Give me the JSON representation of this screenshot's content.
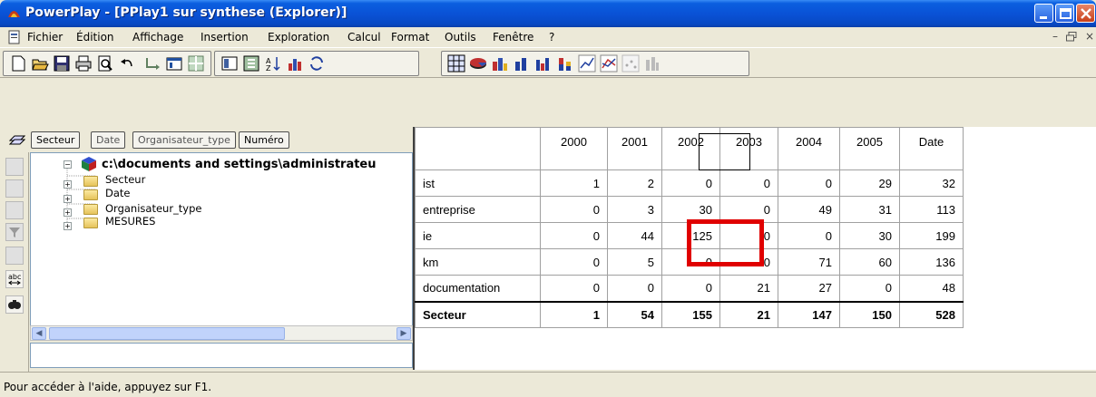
{
  "window": {
    "title": "PowerPlay - [PPlay1 sur synthese (Explorer)]"
  },
  "menu": {
    "items": [
      "Fichier",
      "Édition",
      "Affichage",
      "Insertion",
      "Exploration",
      "Calcul",
      "Format",
      "Outils",
      "Fenêtre",
      "?"
    ]
  },
  "dimension_line": {
    "buttons": [
      "Secteur",
      "Date",
      "Organisateur_type",
      "Numéro"
    ]
  },
  "tree": {
    "root": "c:\\documents and settings\\administrateu",
    "items": [
      "Secteur",
      "Date",
      "Organisateur_type",
      "MESURES"
    ]
  },
  "crosstab": {
    "columns": [
      "2000",
      "2001",
      "2002",
      "2003",
      "2004",
      "2005",
      "Date"
    ],
    "rows": [
      {
        "label": "ist",
        "values": [
          "1",
          "2",
          "0",
          "0",
          "0",
          "29",
          "32"
        ]
      },
      {
        "label": "entreprise",
        "values": [
          "0",
          "3",
          "30",
          "0",
          "49",
          "31",
          "113"
        ]
      },
      {
        "label": "ie",
        "values": [
          "0",
          "44",
          "125",
          "0",
          "0",
          "30",
          "199"
        ]
      },
      {
        "label": "km",
        "values": [
          "0",
          "5",
          "0",
          "0",
          "71",
          "60",
          "136"
        ]
      },
      {
        "label": "documentation",
        "values": [
          "0",
          "0",
          "0",
          "21",
          "27",
          "0",
          "48"
        ]
      }
    ],
    "total": {
      "label": "Secteur",
      "values": [
        "1",
        "54",
        "155",
        "21",
        "147",
        "150",
        "528"
      ]
    },
    "highlight_color": "#e00000"
  },
  "status": {
    "text": "Pour accéder à l'aide, appuyez sur F1."
  }
}
